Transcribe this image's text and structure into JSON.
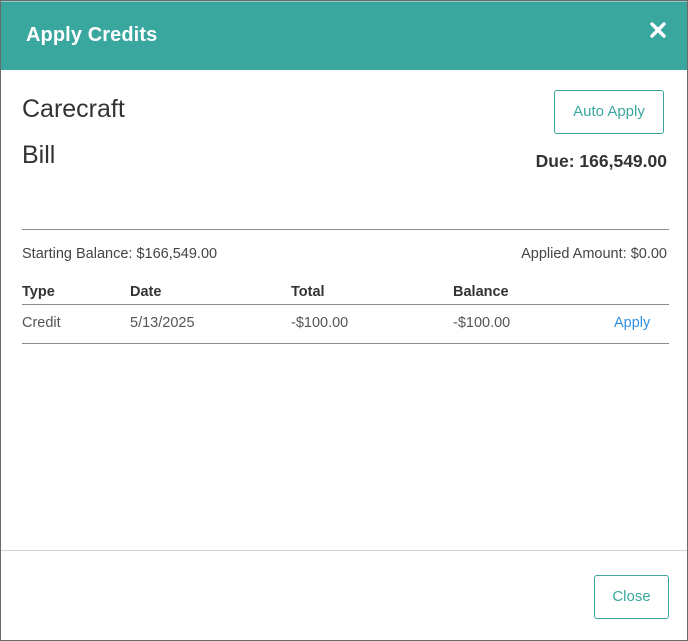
{
  "dialog": {
    "title": "Apply Credits",
    "close_icon": "close-icon"
  },
  "header": {
    "client_name": "Carecraft",
    "doc_type": "Bill",
    "auto_apply_label": "Auto Apply",
    "due_text": "Due: 166,549.00"
  },
  "summary": {
    "starting_balance": "Starting Balance: $166,549.00",
    "applied_amount": "Applied Amount: $0.00"
  },
  "table": {
    "columns": [
      "Type",
      "Date",
      "Total",
      "Balance"
    ],
    "rows": [
      {
        "type": "Credit",
        "date": "5/13/2025",
        "total": "-$100.00",
        "balance": "-$100.00",
        "action": "Apply"
      }
    ]
  },
  "footer": {
    "close_label": "Close"
  },
  "colors": {
    "accent": "#3aa79f",
    "link": "#2f8fe0"
  }
}
